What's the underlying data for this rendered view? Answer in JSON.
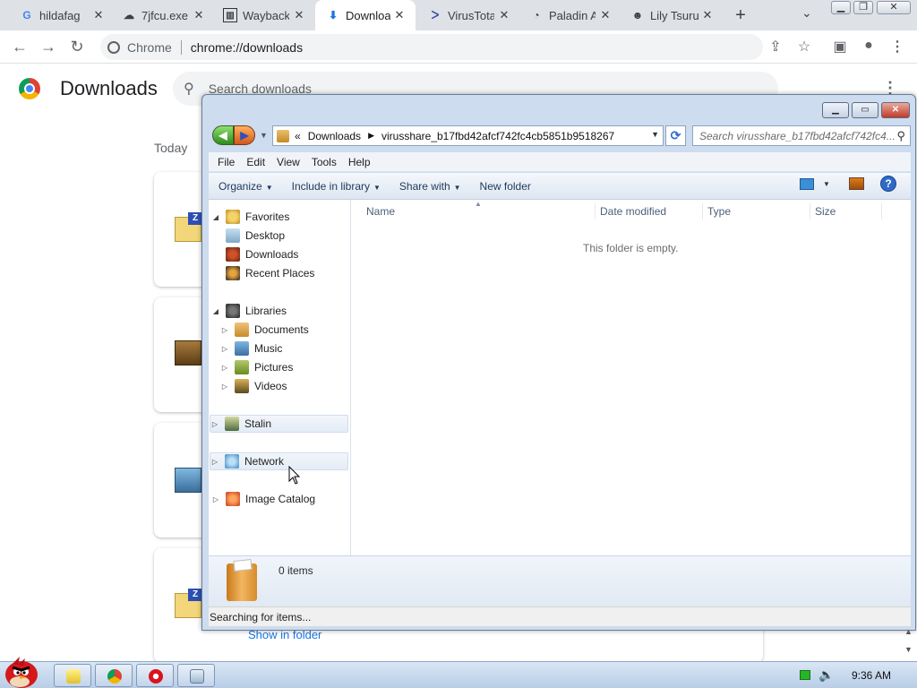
{
  "browser": {
    "tabs": [
      {
        "title": "hildafag",
        "icon": "G",
        "active": false
      },
      {
        "title": "7jfcu.exe",
        "icon": "cloud-upload-icon",
        "active": false
      },
      {
        "title": "Wayback",
        "icon": "wayback-icon",
        "active": false
      },
      {
        "title": "Downloa",
        "icon": "download-icon",
        "active": true
      },
      {
        "title": "VirusTota",
        "icon": "virustotal-icon",
        "active": false
      },
      {
        "title": "Paladin A",
        "icon": "paladin-icon",
        "active": false
      },
      {
        "title": "Lily Tsuru",
        "icon": "lily-icon",
        "active": false
      }
    ],
    "omnibox": {
      "site_label": "Chrome",
      "url": "chrome://downloads"
    }
  },
  "downloads_page": {
    "title": "Downloads",
    "search_placeholder": "Search downloads",
    "section_today": "Today",
    "show_in_folder": "Show in folder"
  },
  "explorer": {
    "address": {
      "chevrons": "«",
      "crumbs": [
        "Downloads",
        "virusshare_b17fbd42afcf742fc4cb5851b9518267"
      ]
    },
    "search_placeholder": "Search virusshare_b17fbd42afcf742fc4...",
    "menu": [
      "File",
      "Edit",
      "View",
      "Tools",
      "Help"
    ],
    "commands": {
      "organize": "Organize",
      "include_in_library": "Include in library",
      "share_with": "Share with",
      "new_folder": "New folder"
    },
    "nav": {
      "favorites": "Favorites",
      "desktop": "Desktop",
      "downloads": "Downloads",
      "recent_places": "Recent Places",
      "libraries": "Libraries",
      "documents": "Documents",
      "music": "Music",
      "pictures": "Pictures",
      "videos": "Videos",
      "stalin": "Stalin",
      "network": "Network",
      "image_catalog": "Image Catalog"
    },
    "columns": {
      "name": "Name",
      "date_modified": "Date modified",
      "type": "Type",
      "size": "Size"
    },
    "empty_message": "This folder is empty.",
    "details": {
      "item_count": "0 items"
    },
    "status": "Searching for items..."
  },
  "taskbar": {
    "clock": "9:36 AM"
  }
}
